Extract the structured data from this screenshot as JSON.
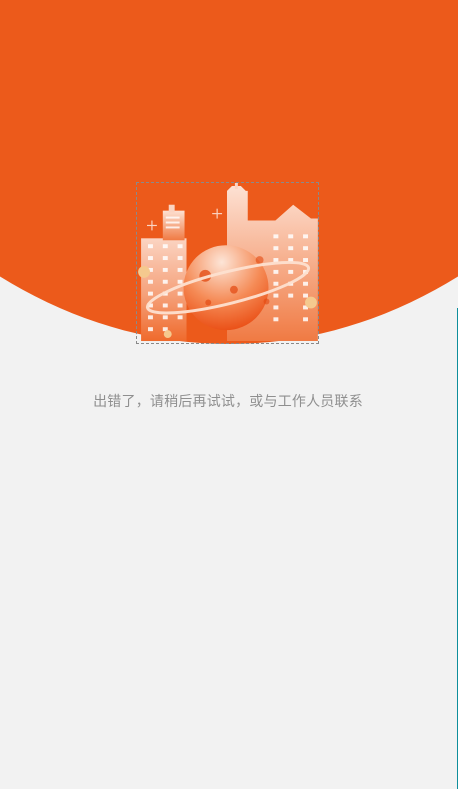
{
  "error": {
    "message": "出错了，请稍后再试试，或与工作人员联系"
  },
  "colors": {
    "brand_orange": "#ec5a1b",
    "background": "#f2f2f2",
    "text_gray": "#8f8f8f"
  },
  "illustration": {
    "icon": "city-planet-illustration"
  }
}
